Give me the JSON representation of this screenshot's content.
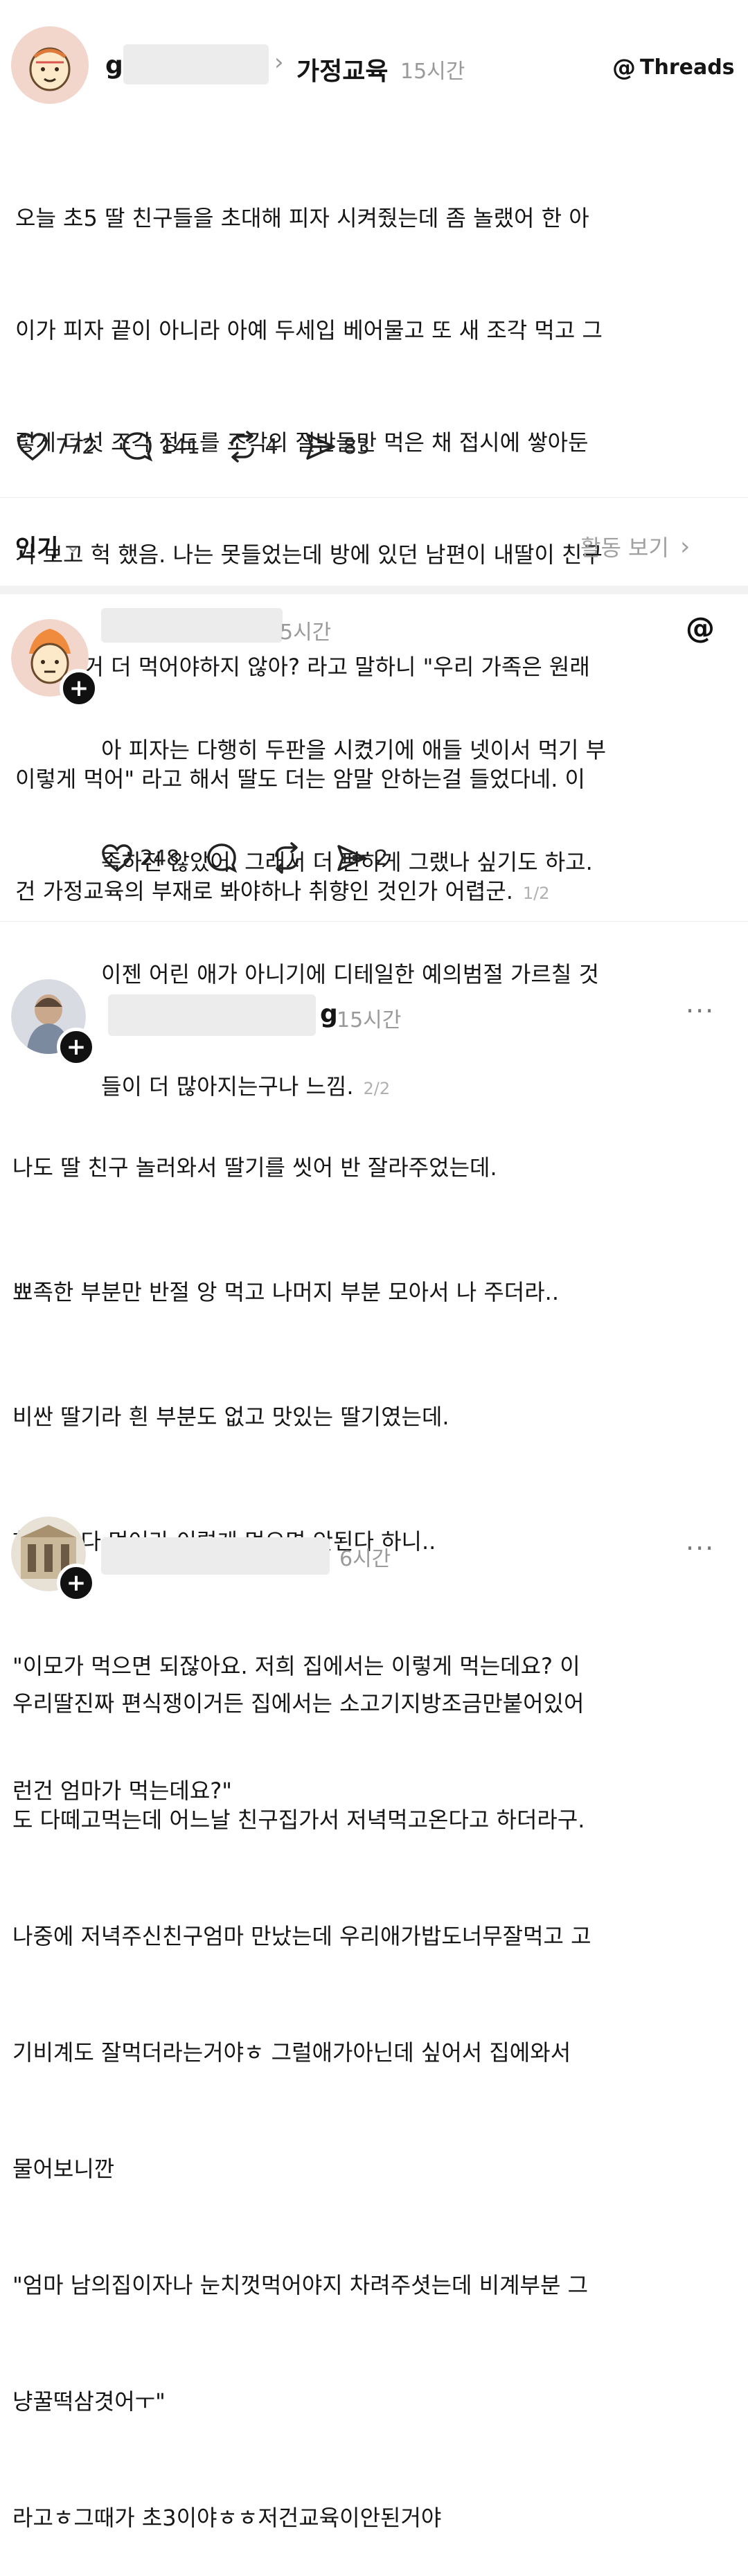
{
  "post": {
    "username": "g",
    "topic": "가정교육",
    "time": "15시간",
    "brand": "Threads",
    "lines": [
      "오늘 초5 딸 친구들을 초대해 피자 시켜줬는데 좀 놀랬어 한 아",
      "이가 피자 끝이 아니라 아예 두세입 베어물고 또 새 조각 먹고 그",
      "렇게 다섯 조각 정도를 조각의 절반들만 먹은 채 접시에 쌓아둔",
      "거 보고 헉 했음. 나는 못들었는데 방에 있던 남편이 내딸이 친구",
      "에게 그거 더 먹어야하지 않아? 라고 말하니 \"우리 가족은 원래",
      "이렇게 먹어\" 라고 해서 딸도 더는 암말 안하는걸 들었다네. 이",
      "건 가정교육의 부재로 봐야하나 취향인 것인가 어렵군."
    ],
    "page": "1/2",
    "likes": "772",
    "comments": "141",
    "reposts": "4",
    "shares": "83"
  },
  "sort": {
    "label": "인기",
    "activity": "활동 보기"
  },
  "reply1": {
    "time": "5시간",
    "lines": [
      "아 피자는 다행히 두판을 시켰기에 애들 넷이서 먹기 부",
      "족하진 않았어. 그래서 더 편하게 그랬나 싶기도 하고.",
      "이젠 어린 애가 아니기에 디테일한 예의범절 가르칠 것",
      "들이 더 많아지는구나 느낌."
    ],
    "page": "2/2",
    "likes": "248",
    "shares": "2"
  },
  "reply2": {
    "name_end": "g",
    "time": "15시간",
    "lines": [
      "나도 딸 친구 놀러와서 딸기를 씻어 반 잘라주었는데.",
      "뾰족한 부분만 반절 앙 먹고 나머지 부분 모아서 나 주더라..",
      "비싼 딸기라 흰 부분도 없고 맛있는 딸기였는데.",
      "한입에 다 먹어라 이렇게 먹으면 안된다 하니..",
      "\"이모가 먹으면 되잖아요. 저희 집에서는 이렇게 먹는데요? 이",
      "런건 엄마가 먹는데요?\""
    ]
  },
  "reply3": {
    "time": "6시간",
    "lines": [
      "우리딸진짜 편식쟁이거든 집에서는 소고기지방조금만붙어있어",
      "도 다떼고먹는데 어느날 친구집가서 저녁먹고온다고 하더라구.",
      "나중에 저녁주신친구엄마 만났는데 우리애가밥도너무잘먹고 고",
      "기비계도 잘먹더라는거야ㅎ 그럴애가아닌데 싶어서 집에와서",
      "물어보니깐",
      "\"엄마 남의집이자나 눈치껏먹어야지 차려주셧는데 비계부분 그",
      "냥꿀떡삼겻어ㅜ\"",
      "라고ㅎ그때가 초3이야ㅎㅎ저건교육이안된거야"
    ]
  }
}
